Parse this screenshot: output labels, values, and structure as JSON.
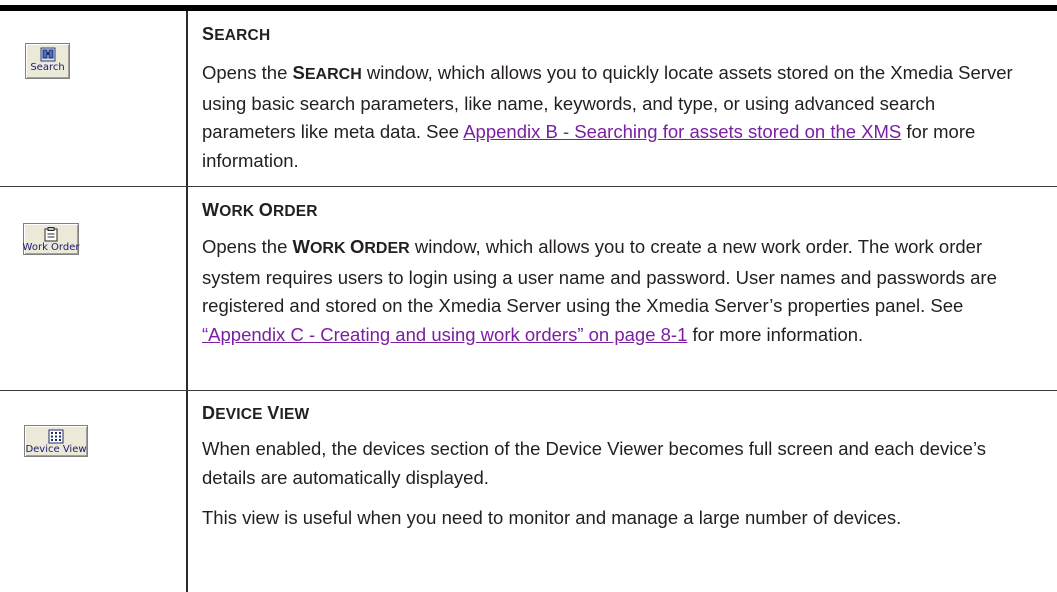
{
  "rows": [
    {
      "button_label": "Search",
      "icon": "binoculars-icon",
      "heading": "SEARCH",
      "para_pre": "Opens the ",
      "para_bold": "SEARCH",
      "para_mid": " window, which allows you to quickly locate assets stored on the Xmedia Server using basic search parameters, like name, keywords, and type, or using advanced search parameters like meta data. See ",
      "link": "Appendix B - Searching for assets stored on the XMS",
      "para_post": " for more information."
    },
    {
      "button_label": "Work Order",
      "icon": "clipboard-icon",
      "heading": "WORK ORDER",
      "para_pre": "Opens the ",
      "para_bold": "WORK ORDER",
      "para_mid": " window, which allows you to create a new work order. The work order system requires users to login using a user name and password. User names and passwords are registered and stored on the Xmedia Server using the Xmedia Server’s properties panel. See ",
      "link": "“Appendix C - Creating and using work orders” on page 8-1",
      "para_post": " for more information."
    },
    {
      "button_label": "Device View",
      "icon": "grid-icon",
      "heading": "DEVICE VIEW",
      "para1": "When enabled, the devices section of the Device Viewer becomes full screen and each device’s details are automatically displayed.",
      "para2": "This view is useful when you need to monitor and manage a large number of devices."
    }
  ],
  "colors": {
    "link": "#7b1ea2",
    "text": "#231f20"
  }
}
